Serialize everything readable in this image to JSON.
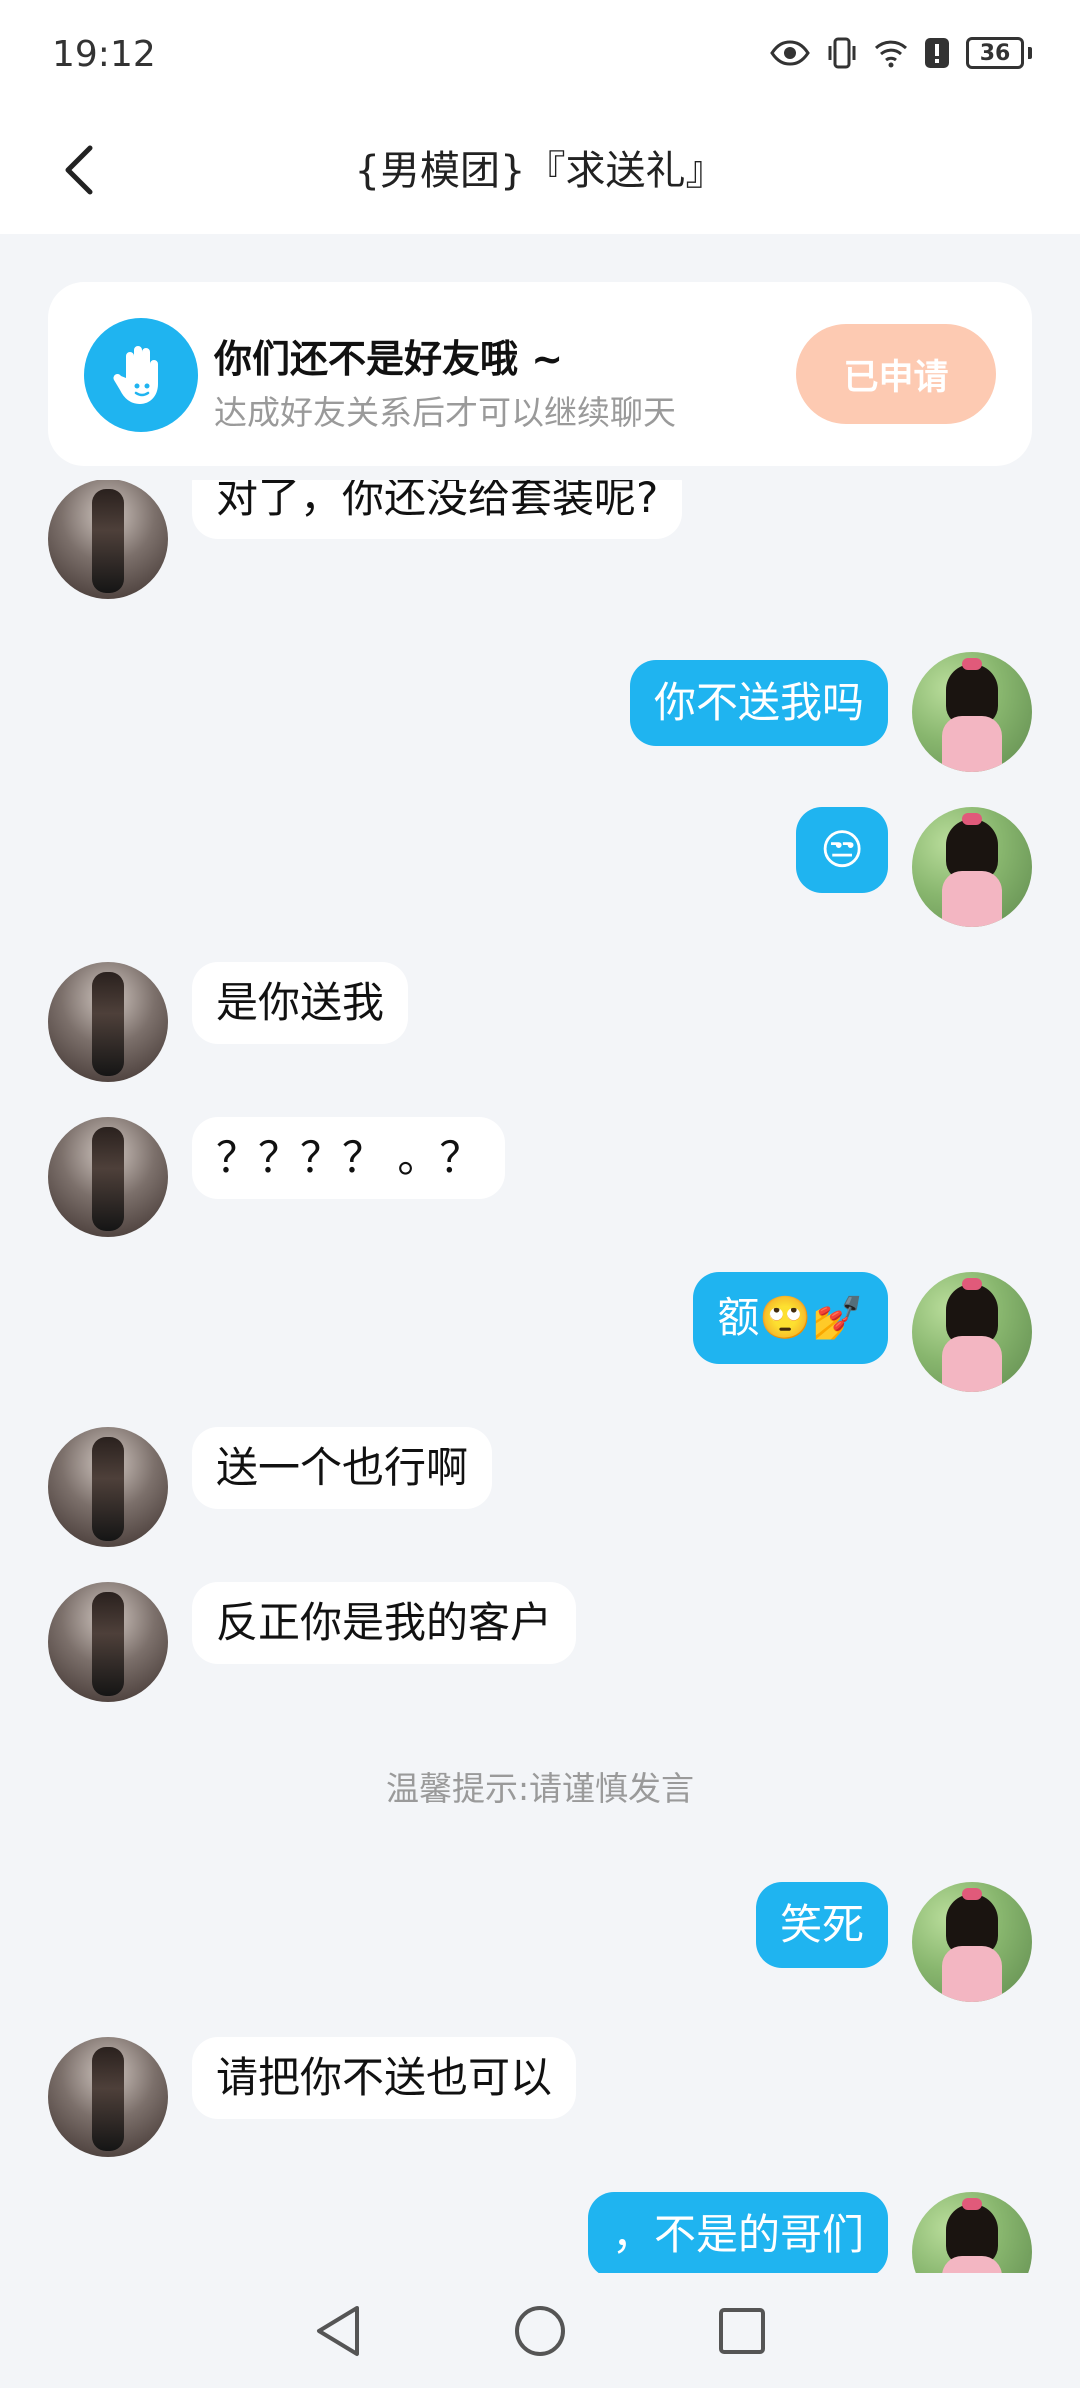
{
  "status_bar": {
    "time": "19:12",
    "battery": "36"
  },
  "header": {
    "title": "{男模团}『求送礼』"
  },
  "friend_notice": {
    "title": "你们还不是好友哦 ~",
    "subtitle": "达成好友关系后才可以继续聊天",
    "button": "已申请"
  },
  "messages": [
    {
      "side": "left",
      "text": "对了，你还没给套装呢?"
    },
    {
      "side": "right",
      "text": "你不送我吗"
    },
    {
      "side": "right",
      "text": "😒"
    },
    {
      "side": "left",
      "text": "是你送我"
    },
    {
      "side": "left",
      "text": "？？？？ 。？"
    },
    {
      "side": "right",
      "text": "额🙄💅"
    },
    {
      "side": "left",
      "text": "送一个也行啊"
    },
    {
      "side": "left",
      "text": "反正你是我的客户"
    },
    {
      "side": "right",
      "text": "笑死"
    },
    {
      "side": "left",
      "text": "请把你不送也可以"
    },
    {
      "side": "right",
      "text": "，不是的哥们"
    }
  ],
  "system_tip": "温馨提示:请谨慎发言",
  "icons": {
    "back": "chevron-left-icon",
    "eye": "eye-icon",
    "vibrate": "vibrate-icon",
    "wifi": "wifi-icon",
    "alert": "alert-icon",
    "hand": "hand-wave-icon",
    "nav_back": "triangle-back-icon",
    "nav_home": "circle-home-icon",
    "nav_recent": "square-recent-icon"
  },
  "colors": {
    "accent": "#1fb4f0",
    "applied_button": "#fdcab2",
    "background": "#f3f5f8"
  }
}
